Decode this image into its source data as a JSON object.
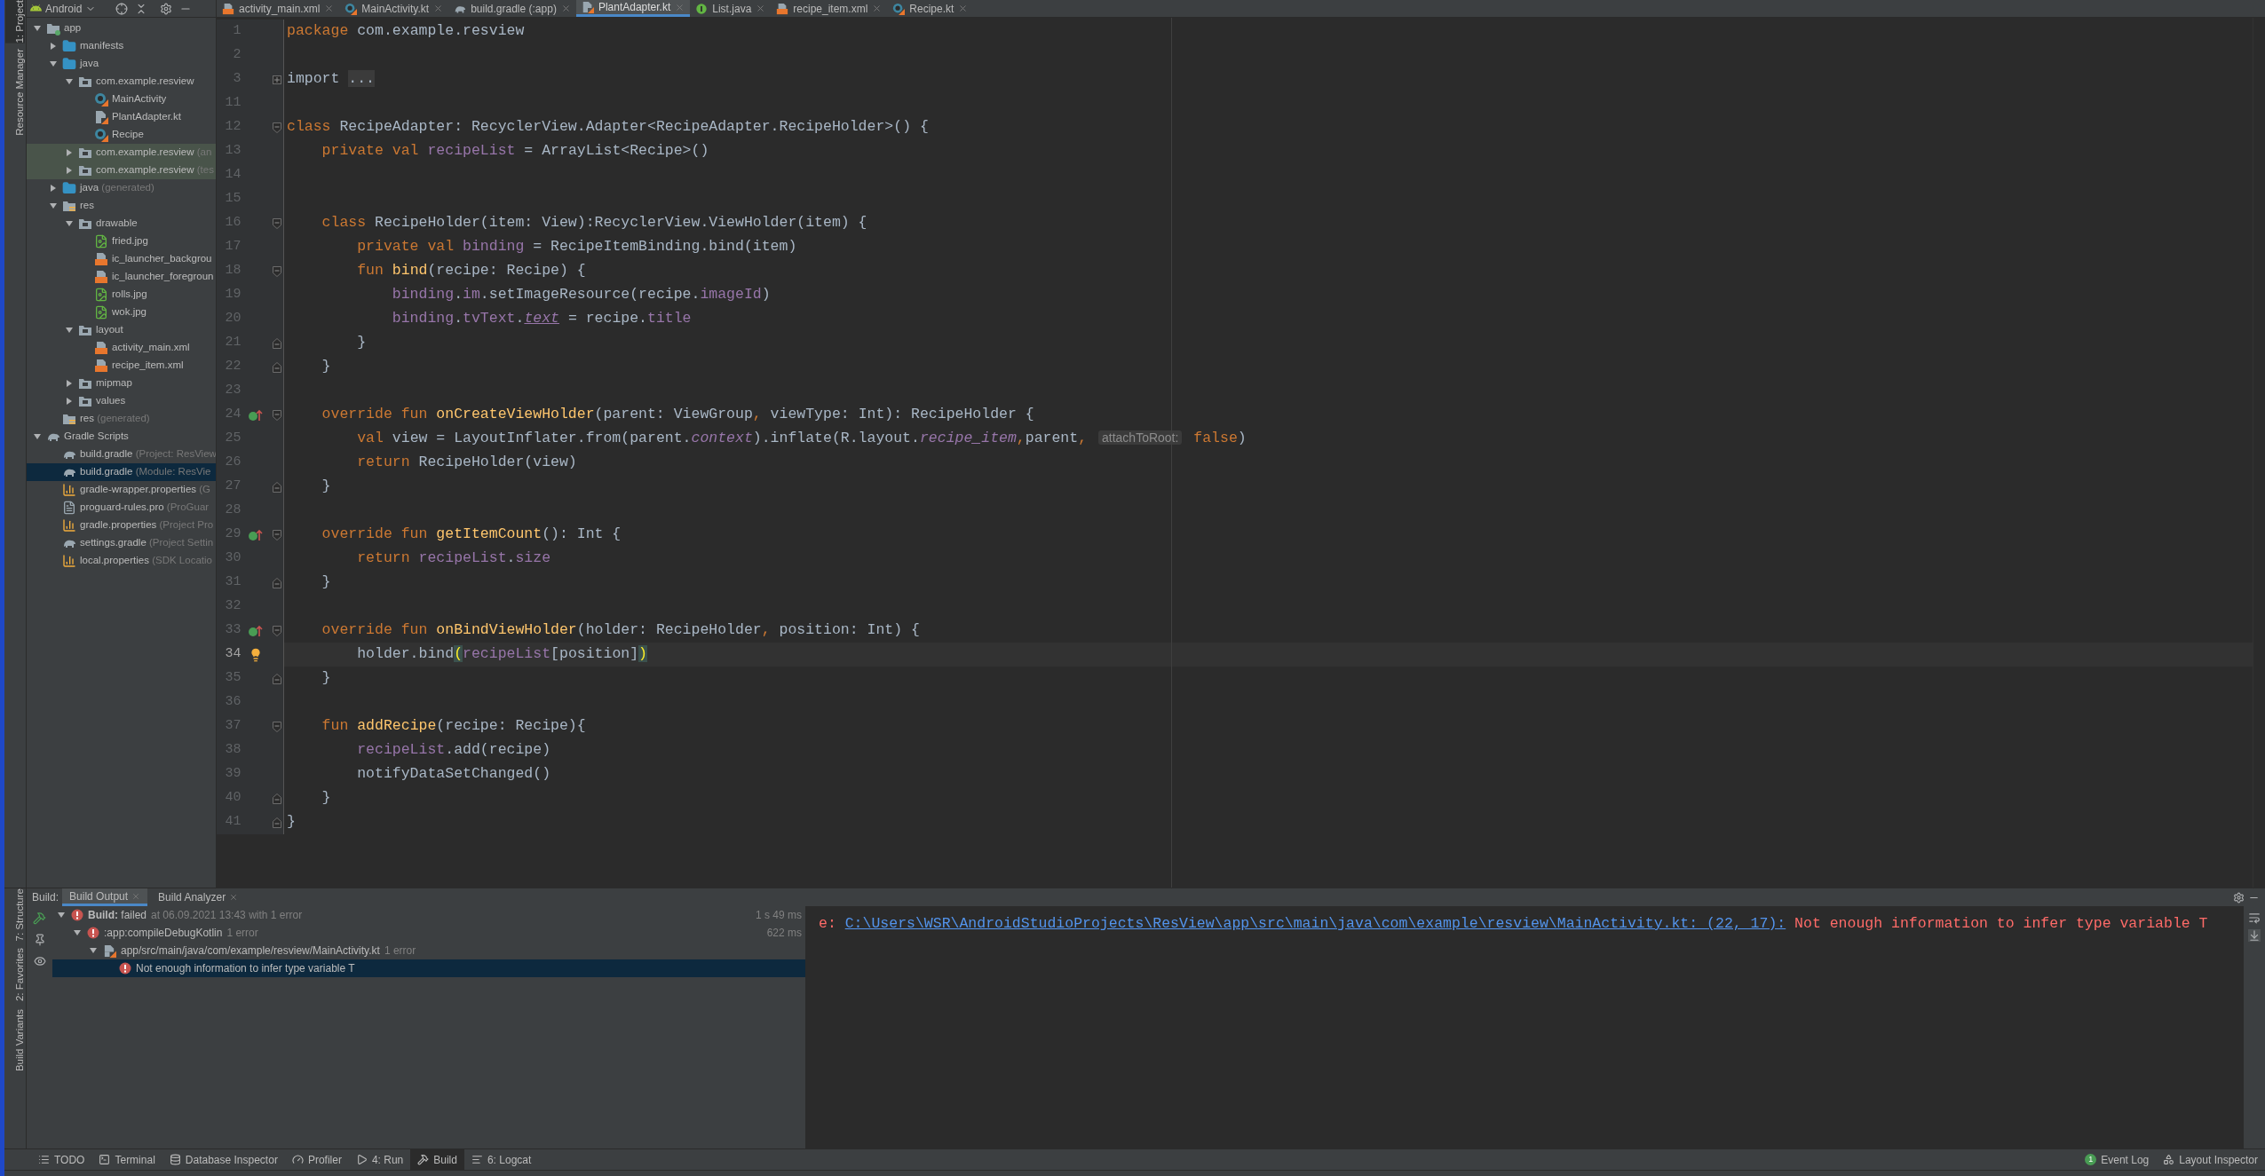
{
  "left_stripe": {
    "top": [
      {
        "label": "1: Project",
        "selected": true
      },
      {
        "label": "Resource Manager",
        "selected": false
      }
    ],
    "bottom": [
      {
        "label": "7: Structure",
        "selected": false
      },
      {
        "label": "2: Favorites",
        "selected": false
      },
      {
        "label": "Build Variants",
        "selected": false
      }
    ]
  },
  "project_panel": {
    "view": "Android",
    "tree": [
      {
        "label": "app",
        "kind": "module",
        "expanded": true,
        "selected": false,
        "highlighted": false,
        "children": [
          {
            "label": "manifests",
            "kind": "folder",
            "expanded": false,
            "selected": false,
            "highlighted": false
          },
          {
            "label": "java",
            "kind": "folder",
            "expanded": true,
            "selected": false,
            "highlighted": false,
            "children": [
              {
                "label": "com.example.resview",
                "kind": "package",
                "expanded": true,
                "selected": false,
                "highlighted": false,
                "children": [
                  {
                    "label": "MainActivity",
                    "kind": "kotlin-class",
                    "selected": false,
                    "highlighted": false
                  },
                  {
                    "label": "PlantAdapter.kt",
                    "kind": "kotlin-file",
                    "selected": false,
                    "highlighted": false
                  },
                  {
                    "label": "Recipe",
                    "kind": "kotlin-class",
                    "selected": false,
                    "highlighted": false
                  }
                ]
              },
              {
                "label": "com.example.resview",
                "hint": "(an",
                "kind": "package",
                "expanded": false,
                "selected": false,
                "highlighted": true
              },
              {
                "label": "com.example.resview",
                "hint": "(tes",
                "kind": "package",
                "expanded": false,
                "selected": false,
                "highlighted": true
              }
            ]
          },
          {
            "label": "java",
            "hint": "(generated)",
            "kind": "folder",
            "expanded": false,
            "selected": false,
            "highlighted": false
          },
          {
            "label": "res",
            "kind": "res-folder",
            "expanded": true,
            "selected": false,
            "highlighted": false,
            "children": [
              {
                "label": "drawable",
                "kind": "package",
                "expanded": true,
                "selected": false,
                "highlighted": false,
                "children": [
                  {
                    "label": "fried.jpg",
                    "kind": "image",
                    "selected": false,
                    "highlighted": false
                  },
                  {
                    "label": "ic_launcher_backgrou",
                    "kind": "xml",
                    "selected": false,
                    "highlighted": false
                  },
                  {
                    "label": "ic_launcher_foregroun",
                    "kind": "xml",
                    "selected": false,
                    "highlighted": false
                  },
                  {
                    "label": "rolls.jpg",
                    "kind": "image",
                    "selected": false,
                    "highlighted": false
                  },
                  {
                    "label": "wok.jpg",
                    "kind": "image",
                    "selected": false,
                    "highlighted": false
                  }
                ]
              },
              {
                "label": "layout",
                "kind": "package",
                "expanded": true,
                "selected": false,
                "highlighted": false,
                "children": [
                  {
                    "label": "activity_main.xml",
                    "kind": "xml",
                    "selected": false,
                    "highlighted": false
                  },
                  {
                    "label": "recipe_item.xml",
                    "kind": "xml",
                    "selected": false,
                    "highlighted": false
                  }
                ]
              },
              {
                "label": "mipmap",
                "kind": "package",
                "expanded": false,
                "selected": false,
                "highlighted": false
              },
              {
                "label": "values",
                "kind": "package",
                "expanded": false,
                "selected": false,
                "highlighted": false
              }
            ]
          },
          {
            "label": "res",
            "hint": "(generated)",
            "kind": "res-folder",
            "selected": false,
            "highlighted": false
          }
        ]
      },
      {
        "label": "Gradle Scripts",
        "kind": "gradle",
        "expanded": true,
        "selected": false,
        "highlighted": false,
        "children": [
          {
            "label": "build.gradle",
            "hint": "(Project: ResView",
            "kind": "gradle",
            "selected": false,
            "highlighted": false
          },
          {
            "label": "build.gradle",
            "hint": "(Module: ResVie",
            "kind": "gradle",
            "selected": true,
            "highlighted": false
          },
          {
            "label": "gradle-wrapper.properties",
            "hint": "(G",
            "kind": "properties",
            "selected": false,
            "highlighted": false
          },
          {
            "label": "proguard-rules.pro",
            "hint": "(ProGuar",
            "kind": "text",
            "selected": false,
            "highlighted": false
          },
          {
            "label": "gradle.properties",
            "hint": "(Project Pro",
            "kind": "properties",
            "selected": false,
            "highlighted": false
          },
          {
            "label": "settings.gradle",
            "hint": "(Project Settin",
            "kind": "gradle",
            "selected": false,
            "highlighted": false
          },
          {
            "label": "local.properties",
            "hint": "(SDK Locatio",
            "kind": "properties",
            "selected": false,
            "highlighted": false
          }
        ]
      }
    ]
  },
  "editor": {
    "tabs": [
      {
        "label": "activity_main.xml",
        "kind": "xml",
        "selected": false
      },
      {
        "label": "MainActivity.kt",
        "kind": "kotlin-class",
        "selected": false
      },
      {
        "label": "build.gradle (:app)",
        "kind": "gradle",
        "selected": false
      },
      {
        "label": "PlantAdapter.kt",
        "kind": "kotlin-file",
        "selected": true
      },
      {
        "label": "List.java",
        "kind": "java-interface",
        "selected": false
      },
      {
        "label": "recipe_item.xml",
        "kind": "xml",
        "selected": false
      },
      {
        "label": "Recipe.kt",
        "kind": "kotlin-class",
        "selected": false
      }
    ],
    "lines": [
      {
        "number": "1",
        "current": false,
        "tokens": [
          {
            "kind": "kw",
            "text": "package "
          },
          {
            "kind": "plain",
            "text": "com.example.resview"
          }
        ]
      },
      {
        "number": "2",
        "current": false
      },
      {
        "number": "3",
        "current": false,
        "gutter_icons": [
          {
            "kind": "fold-plus"
          }
        ],
        "tokens": [
          {
            "kind": "plain",
            "text": "import "
          },
          {
            "kind": "folded",
            "text": "..."
          }
        ]
      },
      {
        "number": "11",
        "current": false
      },
      {
        "number": "12",
        "current": false,
        "gutter_icons": [
          {
            "kind": "fold-start"
          }
        ],
        "tokens": [
          {
            "kind": "kw",
            "text": "class "
          },
          {
            "kind": "plain",
            "text": "RecipeAdapter: RecyclerView.Adapter<RecipeAdapter.RecipeHolder>() {"
          }
        ]
      },
      {
        "number": "13",
        "current": false,
        "tokens": [
          {
            "kind": "kw",
            "text": "    private val "
          },
          {
            "kind": "field",
            "text": "recipeList"
          },
          {
            "kind": "plain",
            "text": " = ArrayList<Recipe>()"
          }
        ]
      },
      {
        "number": "14",
        "current": false
      },
      {
        "number": "15",
        "current": false
      },
      {
        "number": "16",
        "current": false,
        "gutter_icons": [
          {
            "kind": "fold-start"
          }
        ],
        "tokens": [
          {
            "kind": "kw",
            "text": "    class "
          },
          {
            "kind": "plain",
            "text": "RecipeHolder(item: View):RecyclerView.ViewHolder(item) {"
          }
        ]
      },
      {
        "number": "17",
        "current": false,
        "tokens": [
          {
            "kind": "kw",
            "text": "        private val "
          },
          {
            "kind": "field",
            "text": "binding"
          },
          {
            "kind": "plain",
            "text": " = RecipeItemBinding.bind(item)"
          }
        ]
      },
      {
        "number": "18",
        "current": false,
        "gutter_icons": [
          {
            "kind": "fold-start"
          }
        ],
        "tokens": [
          {
            "kind": "kw",
            "text": "        fun "
          },
          {
            "kind": "fn",
            "text": "bind"
          },
          {
            "kind": "plain",
            "text": "(recipe: Recipe) {"
          }
        ]
      },
      {
        "number": "19",
        "current": false,
        "tokens": [
          {
            "kind": "field",
            "text": "            binding"
          },
          {
            "kind": "plain",
            "text": "."
          },
          {
            "kind": "field",
            "text": "im"
          },
          {
            "kind": "plain",
            "text": ".setImageResource(recipe."
          },
          {
            "kind": "field",
            "text": "imageId"
          },
          {
            "kind": "plain",
            "text": ")"
          }
        ]
      },
      {
        "number": "20",
        "current": false,
        "tokens": [
          {
            "kind": "field",
            "text": "            binding"
          },
          {
            "kind": "plain",
            "text": "."
          },
          {
            "kind": "field",
            "text": "tvText"
          },
          {
            "kind": "plain",
            "text": "."
          },
          {
            "kind": "synthetic",
            "text": "text"
          },
          {
            "kind": "plain",
            "text": " = recipe."
          },
          {
            "kind": "field",
            "text": "title"
          }
        ]
      },
      {
        "number": "21",
        "current": false,
        "gutter_icons": [
          {
            "kind": "fold-end"
          }
        ],
        "tokens": [
          {
            "kind": "plain",
            "text": "        }"
          }
        ]
      },
      {
        "number": "22",
        "current": false,
        "gutter_icons": [
          {
            "kind": "fold-end"
          }
        ],
        "tokens": [
          {
            "kind": "plain",
            "text": "    }"
          }
        ]
      },
      {
        "number": "23",
        "current": false
      },
      {
        "number": "24",
        "current": false,
        "gutter_icons": [
          {
            "kind": "override"
          },
          {
            "kind": "fold-start"
          }
        ],
        "tokens": [
          {
            "kind": "kw",
            "text": "    override fun "
          },
          {
            "kind": "fn",
            "text": "onCreateViewHolder"
          },
          {
            "kind": "plain",
            "text": "(parent: ViewGroup"
          },
          {
            "kind": "kw",
            "text": ", "
          },
          {
            "kind": "plain",
            "text": "viewType: Int): RecipeHolder {"
          }
        ]
      },
      {
        "number": "25",
        "current": false,
        "tokens": [
          {
            "kind": "kw",
            "text": "        val "
          },
          {
            "kind": "plain",
            "text": "view = LayoutInflater.from(parent."
          },
          {
            "kind": "italic",
            "text": "context"
          },
          {
            "kind": "plain",
            "text": ").inflate(R.layout."
          },
          {
            "kind": "italic",
            "text": "recipe_item"
          },
          {
            "kind": "kw",
            "text": ","
          },
          {
            "kind": "plain",
            "text": "parent"
          },
          {
            "kind": "kw",
            "text": ", "
          },
          {
            "kind": "hint",
            "text": "attachToRoot:"
          },
          {
            "kind": "kw",
            "text": " false"
          },
          {
            "kind": "plain",
            "text": ")"
          }
        ]
      },
      {
        "number": "26",
        "current": false,
        "tokens": [
          {
            "kind": "kw",
            "text": "        return "
          },
          {
            "kind": "plain",
            "text": "RecipeHolder(view)"
          }
        ]
      },
      {
        "number": "27",
        "current": false,
        "gutter_icons": [
          {
            "kind": "fold-end"
          }
        ],
        "tokens": [
          {
            "kind": "plain",
            "text": "    }"
          }
        ]
      },
      {
        "number": "28",
        "current": false
      },
      {
        "number": "29",
        "current": false,
        "gutter_icons": [
          {
            "kind": "override"
          },
          {
            "kind": "fold-start"
          }
        ],
        "tokens": [
          {
            "kind": "kw",
            "text": "    override fun "
          },
          {
            "kind": "fn",
            "text": "getItemCount"
          },
          {
            "kind": "plain",
            "text": "(): Int {"
          }
        ]
      },
      {
        "number": "30",
        "current": false,
        "tokens": [
          {
            "kind": "kw",
            "text": "        return "
          },
          {
            "kind": "field",
            "text": "recipeList"
          },
          {
            "kind": "plain",
            "text": "."
          },
          {
            "kind": "field",
            "text": "size"
          }
        ]
      },
      {
        "number": "31",
        "current": false,
        "gutter_icons": [
          {
            "kind": "fold-end"
          }
        ],
        "tokens": [
          {
            "kind": "plain",
            "text": "    }"
          }
        ]
      },
      {
        "number": "32",
        "current": false
      },
      {
        "number": "33",
        "current": false,
        "gutter_icons": [
          {
            "kind": "override"
          },
          {
            "kind": "fold-start"
          }
        ],
        "tokens": [
          {
            "kind": "kw",
            "text": "    override fun "
          },
          {
            "kind": "fn",
            "text": "onBindViewHolder"
          },
          {
            "kind": "plain",
            "text": "(holder: RecipeHolder"
          },
          {
            "kind": "kw",
            "text": ", "
          },
          {
            "kind": "plain",
            "text": "position: Int) {"
          }
        ]
      },
      {
        "number": "34",
        "current": true,
        "gutter_icons": [
          {
            "kind": "bulb"
          }
        ],
        "tokens": [
          {
            "kind": "plain",
            "text": "        holder.bind"
          },
          {
            "kind": "match",
            "text": "("
          },
          {
            "kind": "field",
            "text": "recipeList"
          },
          {
            "kind": "plain",
            "text": "[position]"
          },
          {
            "kind": "match",
            "text": ")"
          }
        ]
      },
      {
        "number": "35",
        "current": false,
        "gutter_icons": [
          {
            "kind": "fold-end"
          }
        ],
        "tokens": [
          {
            "kind": "plain",
            "text": "    }"
          }
        ]
      },
      {
        "number": "36",
        "current": false
      },
      {
        "number": "37",
        "current": false,
        "gutter_icons": [
          {
            "kind": "fold-start"
          }
        ],
        "tokens": [
          {
            "kind": "kw",
            "text": "    fun "
          },
          {
            "kind": "fn",
            "text": "addRecipe"
          },
          {
            "kind": "plain",
            "text": "(recipe: Recipe){"
          }
        ]
      },
      {
        "number": "38",
        "current": false,
        "tokens": [
          {
            "kind": "field",
            "text": "        recipeList"
          },
          {
            "kind": "plain",
            "text": ".add(recipe)"
          }
        ]
      },
      {
        "number": "39",
        "current": false,
        "tokens": [
          {
            "kind": "plain",
            "text": "        notifyDataSetChanged()"
          }
        ]
      },
      {
        "number": "40",
        "current": false,
        "gutter_icons": [
          {
            "kind": "fold-end"
          }
        ],
        "tokens": [
          {
            "kind": "plain",
            "text": "    }"
          }
        ]
      },
      {
        "number": "41",
        "current": false,
        "gutter_icons": [
          {
            "kind": "fold-end"
          }
        ],
        "tokens": [
          {
            "kind": "plain",
            "text": "}"
          }
        ]
      }
    ]
  },
  "build_panel": {
    "title": "Build:",
    "tabs": [
      {
        "label": "Build Output",
        "selected": true
      },
      {
        "label": "Build Analyzer",
        "selected": false
      }
    ],
    "tree": [
      {
        "kind": "error",
        "label": "**Build:** failed",
        "detail": "at 06.09.2021 13:43 with 1 error",
        "time": "1 s 49 ms",
        "expanded": true,
        "selected": false,
        "children": [
          {
            "kind": "error",
            "label": ":app:compileDebugKotlin",
            "detail": "1 error",
            "time": "622 ms",
            "expanded": true,
            "selected": false,
            "children": [
              {
                "kind": "file",
                "label": "app/src/main/java/com/example/resview/MainActivity.kt",
                "detail": "1 error",
                "expanded": true,
                "selected": false,
                "children": [
                  {
                    "kind": "error",
                    "label": "Not enough information to infer type variable T",
                    "selected": true
                  }
                ]
              }
            ]
          }
        ]
      }
    ],
    "console": [
      {
        "prefix": "e: ",
        "link": "C:\\Users\\WSR\\AndroidStudioProjects\\ResView\\app\\src\\main\\java\\com\\example\\resview\\MainActivity.kt: (22, 17):",
        "message": "Not enough information to infer type variable T"
      }
    ]
  },
  "tool_windows": {
    "left": [
      {
        "label": "TODO",
        "kind": "list",
        "selected": false
      },
      {
        "label": "Terminal",
        "kind": "terminal",
        "selected": false
      },
      {
        "label": "Database Inspector",
        "kind": "database",
        "selected": false
      },
      {
        "label": "Profiler",
        "kind": "gauge",
        "selected": false
      },
      {
        "label": "4: Run",
        "kind": "run",
        "selected": false
      },
      {
        "label": "Build",
        "kind": "hammer",
        "selected": true
      },
      {
        "label": "6: Logcat",
        "kind": "logcat",
        "selected": false
      }
    ],
    "right": [
      {
        "label": "Event Log",
        "kind": "event",
        "badge": "1",
        "selected": false
      },
      {
        "label": "Layout Inspector",
        "kind": "layout",
        "selected": false
      }
    ]
  }
}
